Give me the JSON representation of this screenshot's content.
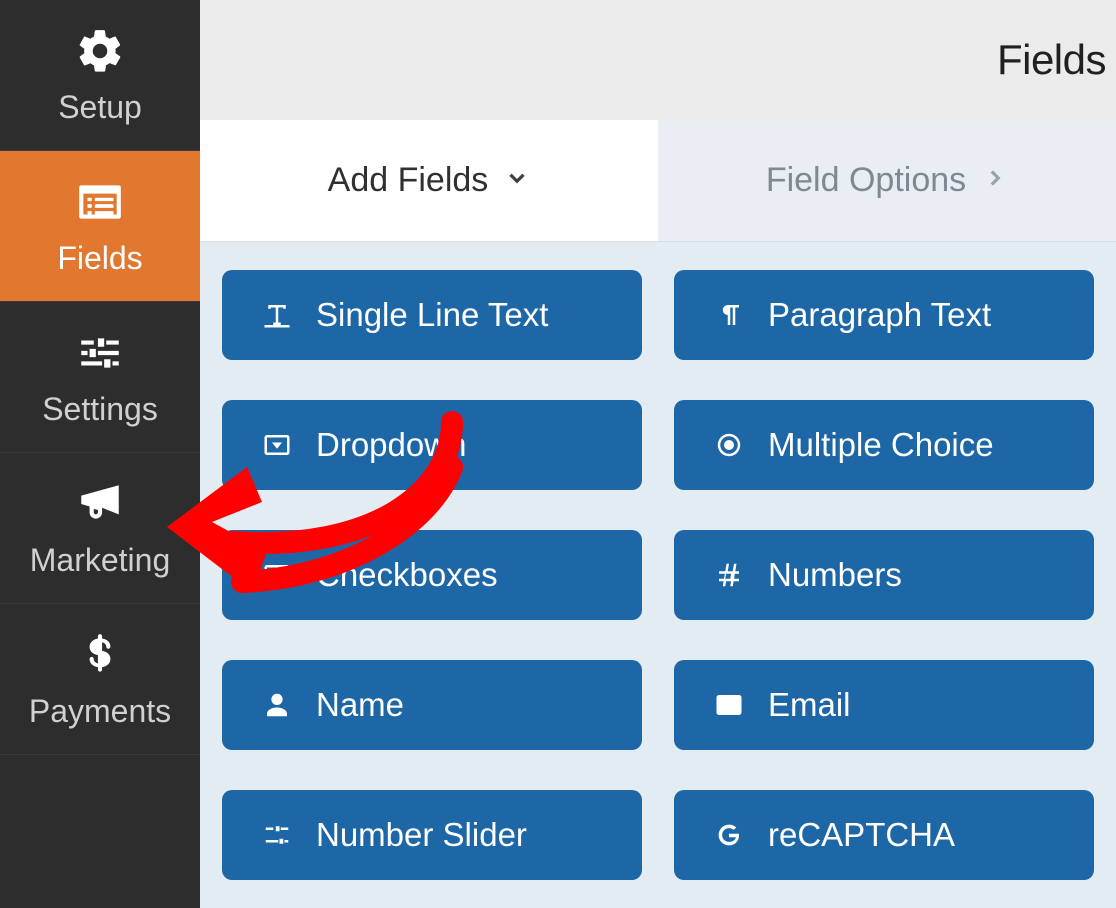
{
  "sidebar": {
    "items": [
      {
        "label": "Setup",
        "icon": "gear-icon"
      },
      {
        "label": "Fields",
        "icon": "list-icon"
      },
      {
        "label": "Settings",
        "icon": "sliders-icon"
      },
      {
        "label": "Marketing",
        "icon": "megaphone-icon"
      },
      {
        "label": "Payments",
        "icon": "dollar-icon"
      }
    ],
    "active": 1
  },
  "header": {
    "title": "Fields"
  },
  "tabs": {
    "add_fields": "Add Fields",
    "field_options": "Field Options",
    "active": 0
  },
  "fields": {
    "rows": [
      [
        {
          "label": "Single Line Text",
          "icon": "text-icon"
        },
        {
          "label": "Paragraph Text",
          "icon": "paragraph-icon"
        }
      ],
      [
        {
          "label": "Dropdown",
          "icon": "dropdown-icon"
        },
        {
          "label": "Multiple Choice",
          "icon": "radio-icon"
        }
      ],
      [
        {
          "label": "Checkboxes",
          "icon": "checkbox-icon"
        },
        {
          "label": "Numbers",
          "icon": "hash-icon"
        }
      ],
      [
        {
          "label": "Name",
          "icon": "person-icon"
        },
        {
          "label": "Email",
          "icon": "envelope-icon"
        }
      ],
      [
        {
          "label": "Number Slider",
          "icon": "slider-icon"
        },
        {
          "label": "reCAPTCHA",
          "icon": "google-icon"
        }
      ]
    ]
  },
  "colors": {
    "sidebar_bg": "#2d2d2d",
    "accent": "#e27730",
    "button_bg": "#1d67a6",
    "panel_bg": "#e3ecf3"
  }
}
